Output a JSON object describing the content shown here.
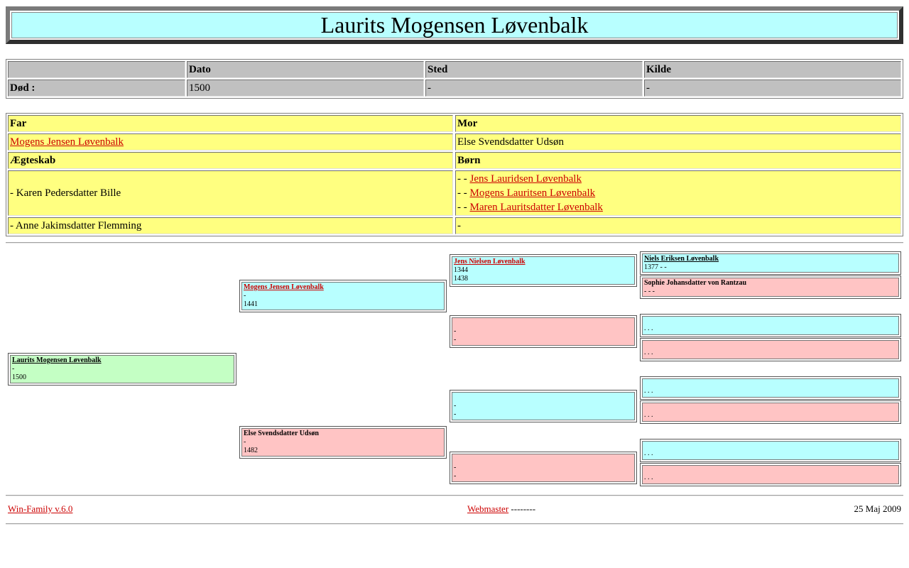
{
  "title": "Laurits Mogensen Løvenbalk",
  "events": {
    "headers": [
      "",
      "Dato",
      "Sted",
      "Kilde"
    ],
    "row": {
      "label": "Død :",
      "date": "1500",
      "place": "-",
      "source": "-"
    }
  },
  "family": {
    "far_label": "Far",
    "mor_label": "Mor",
    "father": "Mogens Jensen Løvenbalk",
    "mother": "Else Svendsdatter Udsøn",
    "marriage_label": "Ægteskab",
    "children_label": "Børn",
    "spouse1": "- Karen Pedersdatter Bille",
    "children_prefix": "- - ",
    "children": [
      "Jens Lauridsen Løvenbalk",
      "Mogens Lauritsen Løvenbalk",
      "Maren Lauritsdatter Løvenbalk"
    ],
    "spouse2": "- Anne Jakimsdatter Flemming",
    "spouse2_children": "-"
  },
  "pedigree": {
    "subject": {
      "name": "Laurits Mogensen Løvenbalk",
      "line1": "-",
      "line2": "1500"
    },
    "father": {
      "name": "Mogens Jensen Løvenbalk",
      "line1": "-",
      "line2": "1441"
    },
    "mother": {
      "name": "Else Svendsdatter Udsøn",
      "line1": "-",
      "line2": "1482"
    },
    "ff": {
      "name": "Jens Nielsen Løvenbalk",
      "line1": "1344",
      "line2": "1438"
    },
    "fm": {
      "line1": "-",
      "line2": "-"
    },
    "mf": {
      "line1": "-",
      "line2": "-"
    },
    "mm": {
      "line1": "-",
      "line2": "-"
    },
    "fff": {
      "name": "Niels Eriksen Løvenbalk",
      "line1": "1377 - -"
    },
    "ffm": {
      "name": "Sophie Johansdatter von Rantzau",
      "line1": "- - -"
    },
    "fmf": {
      "line1": ". . ."
    },
    "fmm": {
      "line1": ". . ."
    },
    "mff": {
      "line1": ". . ."
    },
    "mfm": {
      "line1": ". . ."
    },
    "mmf": {
      "line1": ". . ."
    },
    "mmm": {
      "line1": ". . ."
    }
  },
  "footer": {
    "software": "Win-Family v.6.0",
    "webmaster": "Webmaster",
    "webmaster_suffix": " --------",
    "date": "25 Maj 2009"
  }
}
